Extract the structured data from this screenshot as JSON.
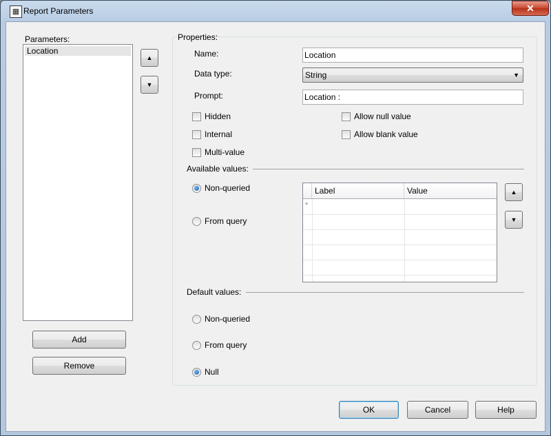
{
  "window": {
    "title": "Report Parameters",
    "close_glyph": "✕",
    "icon_glyph": "▦"
  },
  "parameters": {
    "label": "Parameters:",
    "items": [
      "Location"
    ],
    "up_icon": "▲",
    "down_icon": "▼",
    "add_label": "Add",
    "remove_label": "Remove"
  },
  "properties": {
    "section_label": "Properties:",
    "name_label": "Name:",
    "name_value": "Location",
    "datatype_label": "Data type:",
    "datatype_value": "String",
    "prompt_label": "Prompt:",
    "prompt_value": "Location :",
    "checkboxes": {
      "hidden": "Hidden",
      "internal": "Internal",
      "multi_value": "Multi-value",
      "allow_null": "Allow null value",
      "allow_blank": "Allow blank value"
    }
  },
  "available_values": {
    "label": "Available values:",
    "non_queried": "Non-queried",
    "from_query": "From query",
    "selected": "non_queried",
    "grid": {
      "columns": [
        "Label",
        "Value"
      ],
      "new_row_marker": "*"
    }
  },
  "default_values": {
    "label": "Default values:",
    "non_queried": "Non-queried",
    "from_query": "From query",
    "null": "Null",
    "selected": "null"
  },
  "footer": {
    "ok": "OK",
    "cancel": "Cancel",
    "help": "Help"
  },
  "colors": {
    "accent": "#3c7fb1",
    "frame": "#b8cde4",
    "close": "#c8462e"
  }
}
